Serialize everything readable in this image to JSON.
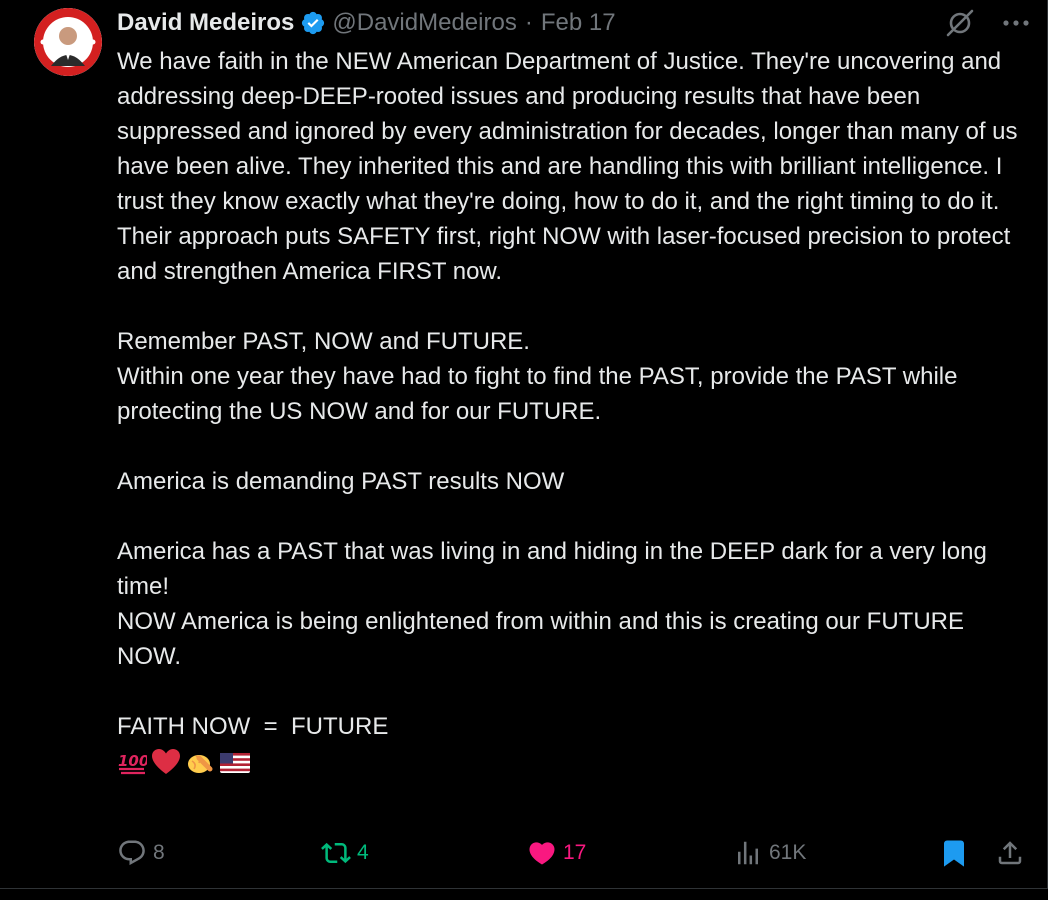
{
  "tweet": {
    "author_name": "David Medeiros",
    "handle": "@DavidMedeiros",
    "separator": "·",
    "date": "Feb 17",
    "paragraphs": [
      "We have faith in the NEW American Department of Justice. They're uncovering and addressing deep-DEEP-rooted issues and producing results that have been suppressed and ignored by every administration for decades, longer than many of us have been alive. They inherited this and are handling this with brilliant intelligence. I trust they know exactly what they're doing, how to do it, and the right timing to do it. Their approach puts SAFETY first, right NOW with laser-focused precision to protect and strengthen America FIRST now.",
      "Remember PAST, NOW and FUTURE.",
      "Within one year they have had to fight to find the PAST, provide the PAST while protecting the US NOW and for our FUTURE.",
      "America is demanding PAST results NOW",
      "America has a PAST that was living in and hiding in the DEEP dark for a very long time!",
      "NOW America is being enlightened from within and this is creating our FUTURE NOW.",
      "FAITH NOW  =  FUTURE"
    ],
    "emojis": [
      "hundred-points",
      "red-heart",
      "pointing-hand",
      "us-flag"
    ]
  },
  "actions": {
    "replies": "8",
    "retweets": "4",
    "likes": "17",
    "views": "61K"
  },
  "icons": {
    "reply": "speech-bubble-icon",
    "retweet": "retweet-icon",
    "like": "heart-icon",
    "views": "bar-chart-icon",
    "bookmark": "bookmark-icon",
    "share": "share-icon",
    "grok": "grok-icon",
    "more": "more-icon",
    "verified": "verified-badge-icon"
  },
  "colors": {
    "background": "#000000",
    "text": "#e7e9ea",
    "secondary": "#71767b",
    "verified": "#1d9bf0",
    "retweet_active": "#00ba7c",
    "like_active": "#f91880",
    "bookmark_active": "#1d9bf0"
  }
}
